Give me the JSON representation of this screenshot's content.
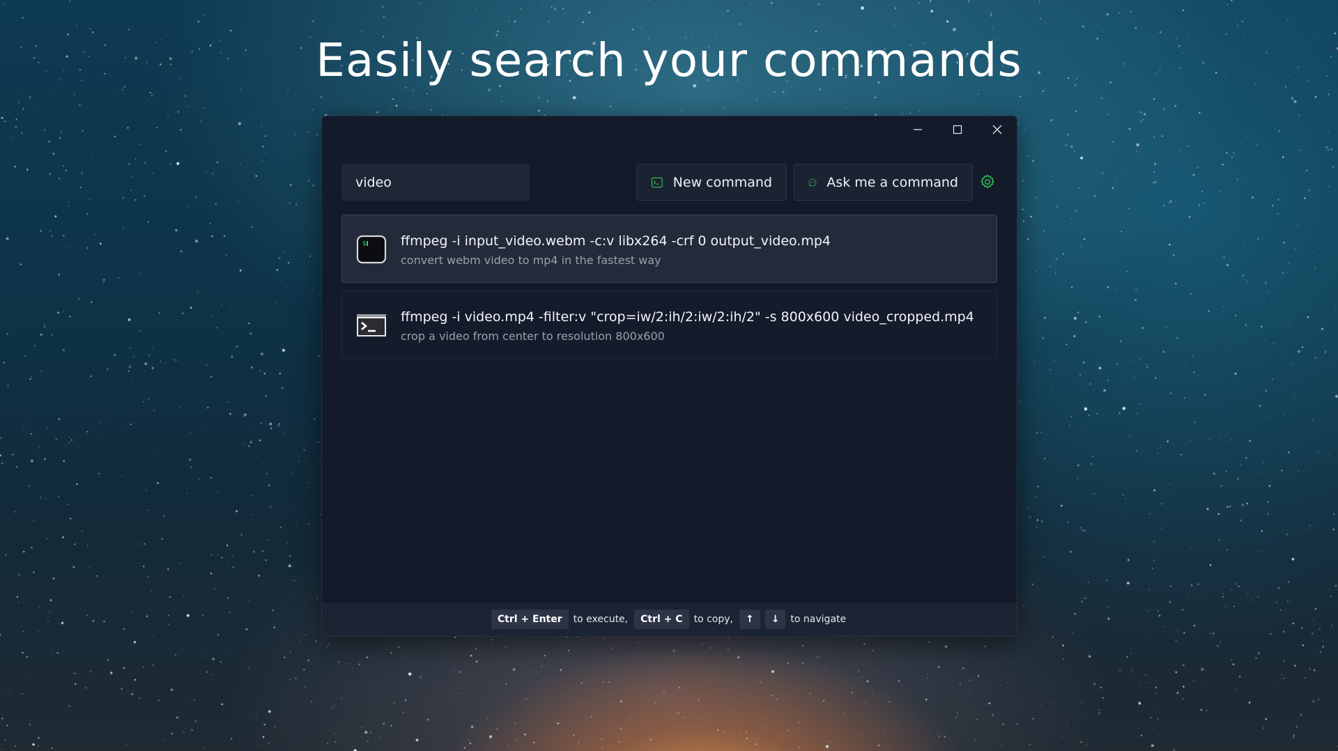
{
  "headline": "Easily search your commands",
  "window": {
    "controls": [
      "minimize",
      "maximize",
      "close"
    ]
  },
  "search": {
    "value": "video",
    "placeholder": ""
  },
  "toolbar": {
    "new_command_label": "New command",
    "ask_label": "Ask me a command",
    "settings_icon": "gear-icon",
    "accent": "#2fbf55"
  },
  "results": [
    {
      "command": "ffmpeg -i input_video.webm -c:v libx264 -crf 0 output_video.mp4",
      "description": "convert webm video to mp4 in the fastest way",
      "icon": "terminal-app-icon",
      "selected": true
    },
    {
      "command": "ffmpeg -i video.mp4 -filter:v \"crop=iw/2:ih/2:iw/2:ih/2\" -s 800x600 video_cropped.mp4",
      "description": "crop a video from center to resolution 800x600",
      "icon": "terminal-prompt-icon",
      "selected": false
    }
  ],
  "footer": {
    "execute_key": "Ctrl + Enter",
    "execute_text": "to execute,",
    "copy_key": "Ctrl + C",
    "copy_text": "to copy,",
    "up_key": "↑",
    "down_key": "↓",
    "navigate_text": "to navigate"
  },
  "colors": {
    "window_bg": "#131a2a",
    "selected_item_bg": "#232a3a",
    "footer_bg": "#1c2333"
  }
}
